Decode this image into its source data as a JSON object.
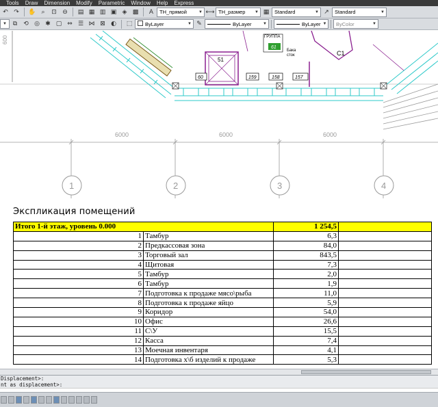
{
  "menubar": {
    "items": [
      "Tools",
      "Draw",
      "Dimension",
      "Modify",
      "Parametric",
      "Window",
      "Help",
      "Express"
    ]
  },
  "toolbar1": {
    "text_style": "TH_прямой",
    "dim_style": "TH_размер",
    "table_style": "Standard",
    "multileader_style": "Standard"
  },
  "toolbar2": {
    "color": "ByLayer",
    "linetype": "ByLayer",
    "lineweight": "ByLayer",
    "plot_style": "ByColor"
  },
  "drawing": {
    "dimensions": [
      "6000",
      "6000",
      "6000"
    ],
    "grid_axes": [
      "1",
      "2",
      "3",
      "4"
    ],
    "side_dimension": "600",
    "rooms": [
      "51",
      "60",
      "159",
      "158",
      "157",
      "61",
      "C1"
    ],
    "labels": {
      "group": "ГРУППА",
      "tank": "Бака",
      "tank_sub": "сток"
    }
  },
  "explication": {
    "title": "Экспликация помещений",
    "total": {
      "label": "Итого 1-й этаж, уровень 0.000",
      "area": "1 254,5"
    },
    "rows": [
      {
        "num": "1",
        "name": "Тамбур",
        "area": "6,3"
      },
      {
        "num": "2",
        "name": "Предкассовая зона",
        "area": "84,0"
      },
      {
        "num": "3",
        "name": "Торговый зал",
        "area": "843,5"
      },
      {
        "num": "4",
        "name": "Щитовая",
        "area": "7,3"
      },
      {
        "num": "5",
        "name": "Тамбур",
        "area": "2,0"
      },
      {
        "num": "6",
        "name": "Тамбур",
        "area": "1,9"
      },
      {
        "num": "7",
        "name": "Подготовка к продаже мясо\\рыба",
        "area": "11,0"
      },
      {
        "num": "8",
        "name": "Подготовка к продаже яйцо",
        "area": "5,9"
      },
      {
        "num": "9",
        "name": "Коридор",
        "area": "54,0"
      },
      {
        "num": "10",
        "name": "Офис",
        "area": "26,6"
      },
      {
        "num": "11",
        "name": "С\\У",
        "area": "15,5"
      },
      {
        "num": "12",
        "name": "Касса",
        "area": "7,4"
      },
      {
        "num": "13",
        "name": "Моечная инвентаря",
        "area": "4,1"
      },
      {
        "num": "14",
        "name": "Подготовка х\\б изделий к продаже",
        "area": "5,3"
      }
    ]
  },
  "commandline": {
    "line1": "Displacement>:",
    "line2": "nt as displacement>:"
  },
  "colors": {
    "total_row_bg": "#ffff00",
    "wall_cyan": "#2ec9c9",
    "room_purple": "#8a1f8f",
    "dim_gray": "#9a9a9a"
  }
}
